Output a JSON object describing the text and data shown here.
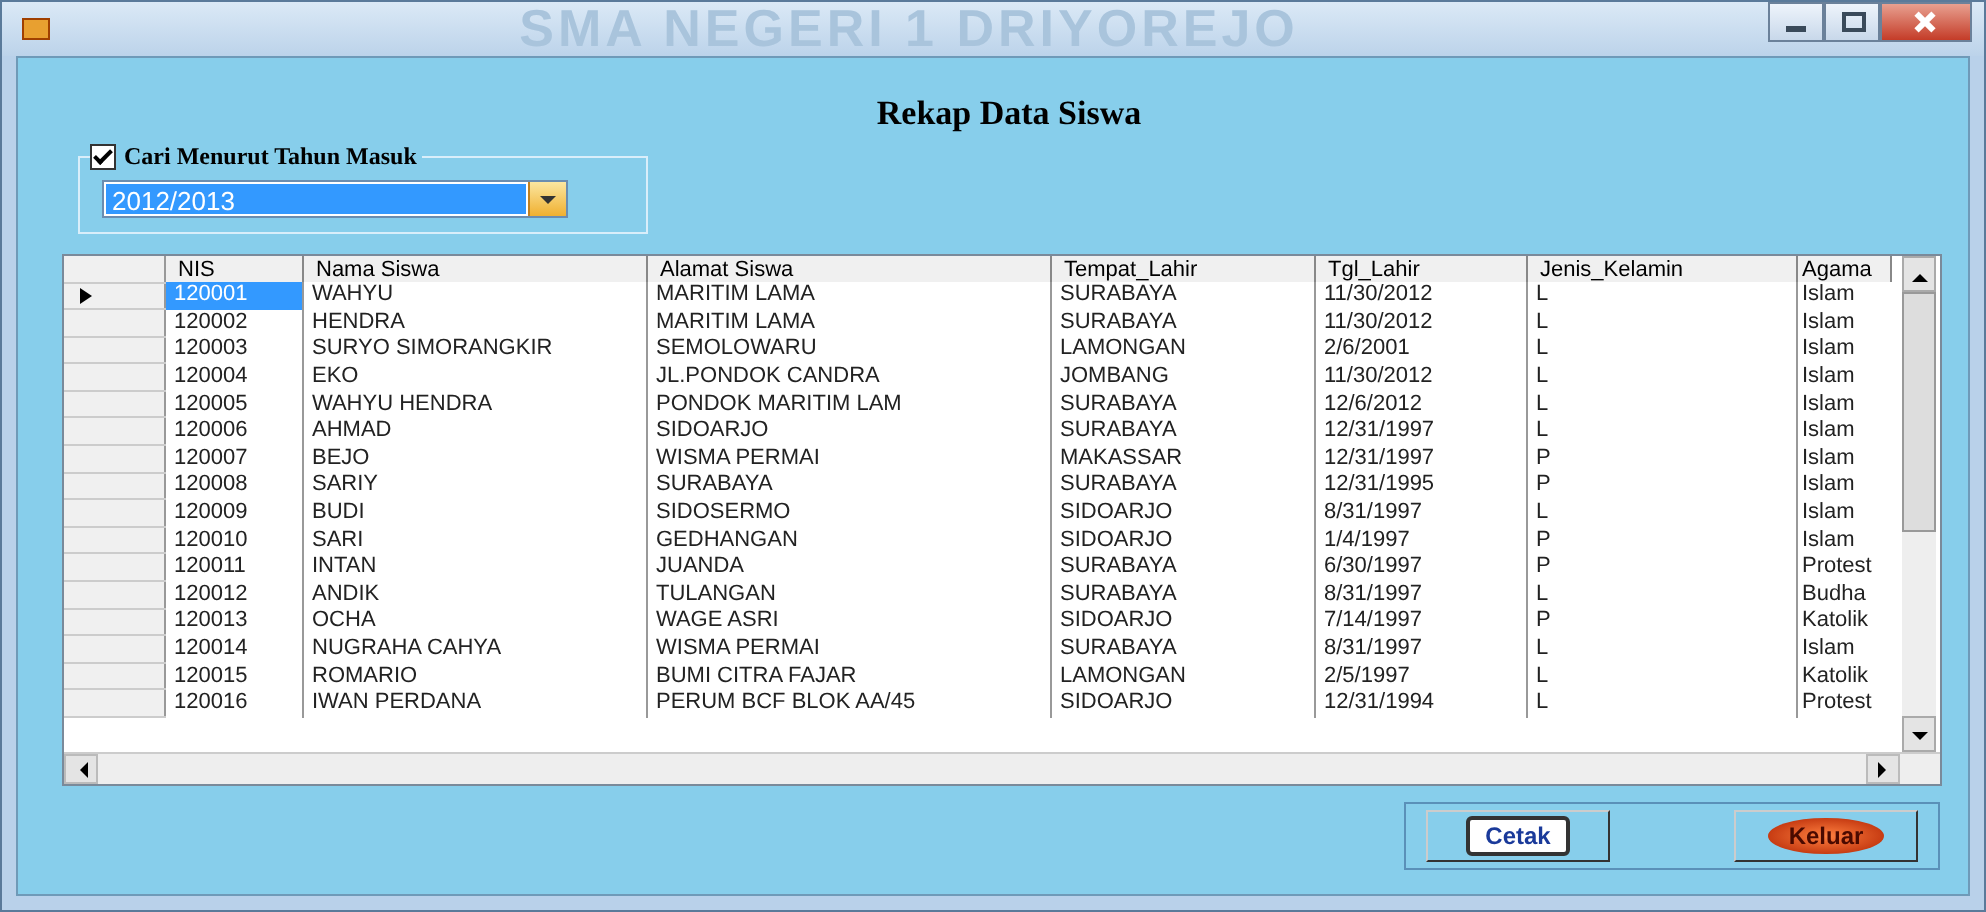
{
  "window": {
    "title": "SMA NEGERI 1 DRIYOREJO"
  },
  "heading": "Rekap Data Siswa",
  "filter": {
    "label": "Cari Menurut Tahun Masuk",
    "checked": true,
    "value": "2012/2013"
  },
  "table": {
    "columns": [
      "NIS",
      "Nama Siswa",
      "Alamat Siswa",
      "Tempat_Lahir",
      "Tgl_Lahir",
      "Jenis_Kelamin",
      "Agama"
    ],
    "rows": [
      {
        "selected": true,
        "cells": [
          "120001",
          "WAHYU",
          "MARITIM LAMA",
          "SURABAYA",
          "11/30/2012",
          "L",
          "Islam"
        ]
      },
      {
        "selected": false,
        "cells": [
          "120002",
          "HENDRA",
          "MARITIM LAMA",
          "SURABAYA",
          "11/30/2012",
          "L",
          "Islam"
        ]
      },
      {
        "selected": false,
        "cells": [
          "120003",
          "SURYO SIMORANGKIR",
          "SEMOLOWARU",
          "LAMONGAN",
          "2/6/2001",
          "L",
          "Islam"
        ]
      },
      {
        "selected": false,
        "cells": [
          "120004",
          "EKO",
          "JL.PONDOK CANDRA",
          "JOMBANG",
          "11/30/2012",
          "L",
          "Islam"
        ]
      },
      {
        "selected": false,
        "cells": [
          "120005",
          "WAHYU HENDRA",
          "PONDOK MARITIM LAM",
          "SURABAYA",
          "12/6/2012",
          "L",
          "Islam"
        ]
      },
      {
        "selected": false,
        "cells": [
          "120006",
          "AHMAD",
          "SIDOARJO",
          "SURABAYA",
          "12/31/1997",
          "L",
          "Islam"
        ]
      },
      {
        "selected": false,
        "cells": [
          "120007",
          "BEJO",
          "WISMA PERMAI",
          "MAKASSAR",
          "12/31/1997",
          "P",
          "Islam"
        ]
      },
      {
        "selected": false,
        "cells": [
          "120008",
          "SARIY",
          "SURABAYA",
          "SURABAYA",
          "12/31/1995",
          "P",
          "Islam"
        ]
      },
      {
        "selected": false,
        "cells": [
          "120009",
          "BUDI",
          "SIDOSERMO",
          "SIDOARJO",
          "8/31/1997",
          "L",
          "Islam"
        ]
      },
      {
        "selected": false,
        "cells": [
          "120010",
          "SARI",
          "GEDHANGAN",
          "SIDOARJO",
          "1/4/1997",
          "P",
          "Islam"
        ]
      },
      {
        "selected": false,
        "cells": [
          "120011",
          "INTAN",
          "JUANDA",
          "SURABAYA",
          "6/30/1997",
          "P",
          "Protest"
        ]
      },
      {
        "selected": false,
        "cells": [
          "120012",
          "ANDIK",
          "TULANGAN",
          "SURABAYA",
          "8/31/1997",
          "L",
          "Budha"
        ]
      },
      {
        "selected": false,
        "cells": [
          "120013",
          "OCHA",
          "WAGE ASRI",
          "SIDOARJO",
          "7/14/1997",
          "P",
          "Katolik"
        ]
      },
      {
        "selected": false,
        "cells": [
          "120014",
          "NUGRAHA CAHYA",
          "WISMA PERMAI",
          "SURABAYA",
          "8/31/1997",
          "L",
          "Islam"
        ]
      },
      {
        "selected": false,
        "cells": [
          "120015",
          "ROMARIO",
          "BUMI CITRA FAJAR",
          "LAMONGAN",
          "2/5/1997",
          "L",
          "Katolik"
        ]
      },
      {
        "selected": false,
        "cells": [
          "120016",
          "IWAN PERDANA",
          "PERUM BCF BLOK AA/45",
          "SIDOARJO",
          "12/31/1994",
          "L",
          "Protest"
        ]
      }
    ]
  },
  "buttons": [
    {
      "kind": "print",
      "label": "Cetak"
    },
    {
      "kind": "exit",
      "label": "Keluar"
    }
  ]
}
